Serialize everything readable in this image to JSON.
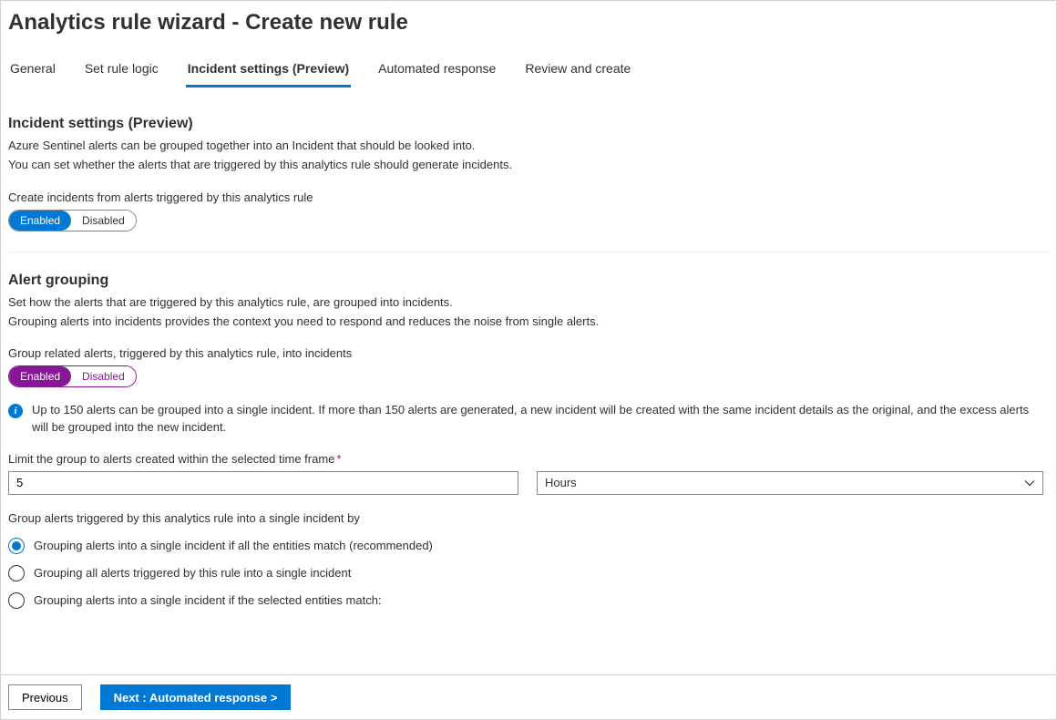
{
  "header": {
    "title": "Analytics rule wizard - Create new rule"
  },
  "tabs": [
    {
      "label": "General"
    },
    {
      "label": "Set rule logic"
    },
    {
      "label": "Incident settings (Preview)",
      "active": true
    },
    {
      "label": "Automated response"
    },
    {
      "label": "Review and create"
    }
  ],
  "incident_settings": {
    "section_title": "Incident settings (Preview)",
    "desc1": "Azure Sentinel alerts can be grouped together into an Incident that should be looked into.",
    "desc2": "You can set whether the alerts that are triggered by this analytics rule should generate incidents.",
    "create_incidents_label": "Create incidents from alerts triggered by this analytics rule",
    "toggle": {
      "enabled": "Enabled",
      "disabled": "Disabled",
      "value": "Enabled"
    }
  },
  "alert_grouping": {
    "section_title": "Alert grouping",
    "desc1": "Set how the alerts that are triggered by this analytics rule, are grouped into incidents.",
    "desc2": "Grouping alerts into incidents provides the context you need to respond and reduces the noise from single alerts.",
    "group_related_label": "Group related alerts, triggered by this analytics rule, into incidents",
    "toggle": {
      "enabled": "Enabled",
      "disabled": "Disabled",
      "value": "Enabled"
    },
    "info_note": "Up to 150 alerts can be grouped into a single incident. If more than 150 alerts are generated, a new incident will be created with the same incident details as the original, and the excess alerts will be grouped into the new incident.",
    "timeframe_label": "Limit the group to alerts created within the selected time frame",
    "timeframe_value": "5",
    "timeframe_unit": "Hours",
    "group_by_label": "Group alerts triggered by this analytics rule into a single incident by",
    "radios": [
      {
        "label": "Grouping alerts into a single incident if all the entities match (recommended)",
        "selected": true
      },
      {
        "label": "Grouping all alerts triggered by this rule into a single incident",
        "selected": false
      },
      {
        "label": "Grouping alerts into a single incident if the selected entities match:",
        "selected": false
      }
    ]
  },
  "footer": {
    "previous": "Previous",
    "next": "Next : Automated response >"
  }
}
